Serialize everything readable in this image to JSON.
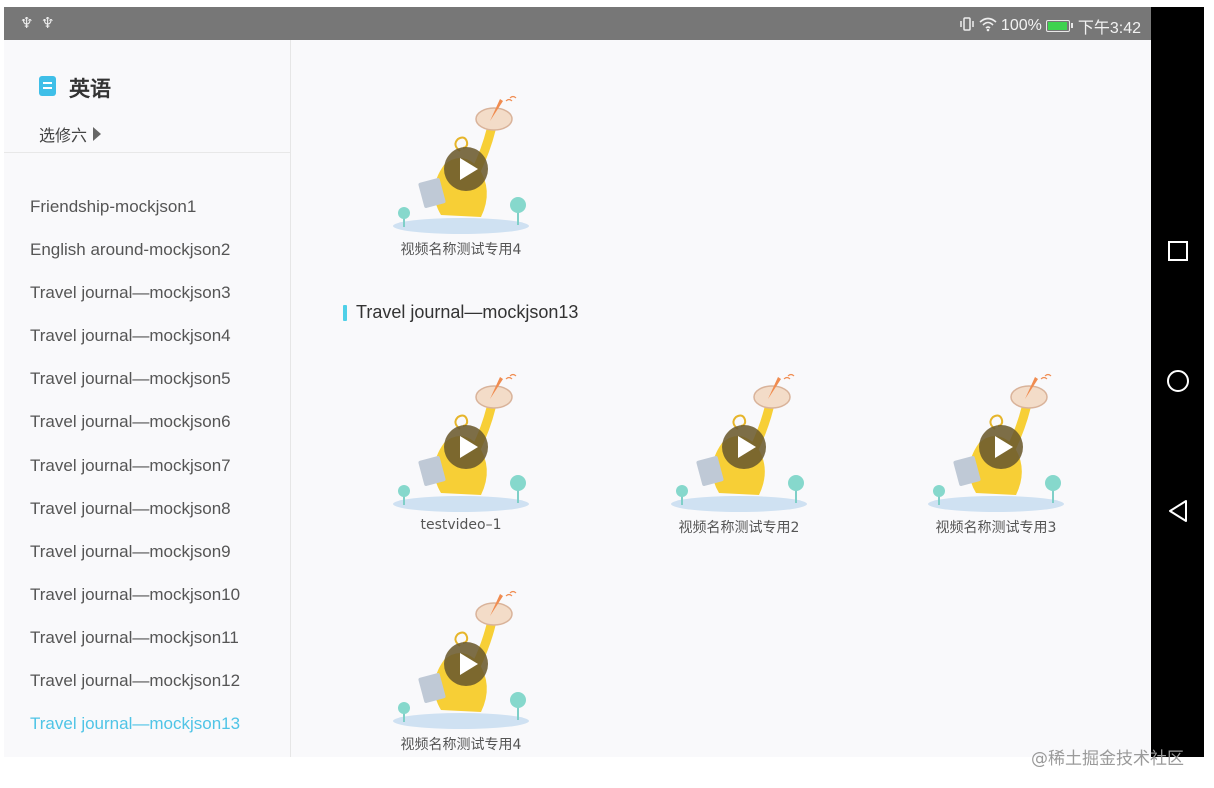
{
  "status_bar": {
    "usb_icons": [
      "usb-icon",
      "usb-icon"
    ],
    "battery_text": "100%",
    "battery_level": 1.0,
    "time": "下午3:42",
    "icons": [
      "vibrate-icon",
      "wifi-icon",
      "battery-icon"
    ]
  },
  "sidebar": {
    "subject_title": "英语",
    "book": "选修六",
    "units": [
      "Friendship-mockjson1",
      "English around-mockjson2",
      "Travel journal—mockjson3",
      "Travel journal—mockjson4",
      "Travel journal—mockjson5",
      "Travel journal—mockjson6",
      "Travel journal—mockjson7",
      "Travel journal—mockjson8",
      "Travel journal—mockjson9",
      "Travel journal—mockjson10",
      "Travel journal—mockjson11",
      "Travel journal—mockjson12",
      "Travel journal—mockjson13"
    ],
    "active_index": 12
  },
  "content": {
    "top_video": {
      "title": "视频名称测试专用4"
    },
    "section": {
      "title": "Travel journal—mockjson13",
      "videos": [
        {
          "title": "testvideo–1"
        },
        {
          "title": "视频名称测试专用2"
        },
        {
          "title": "视频名称测试专用3"
        },
        {
          "title": "视频名称测试专用4"
        }
      ]
    }
  },
  "colors": {
    "accent": "#4fc4e6",
    "status_bar": "#777777",
    "nav_bar": "#000000"
  },
  "nav_bar": {
    "icons": [
      "recent-apps-icon",
      "home-icon",
      "back-icon"
    ]
  },
  "watermark": "@稀土掘金技术社区"
}
